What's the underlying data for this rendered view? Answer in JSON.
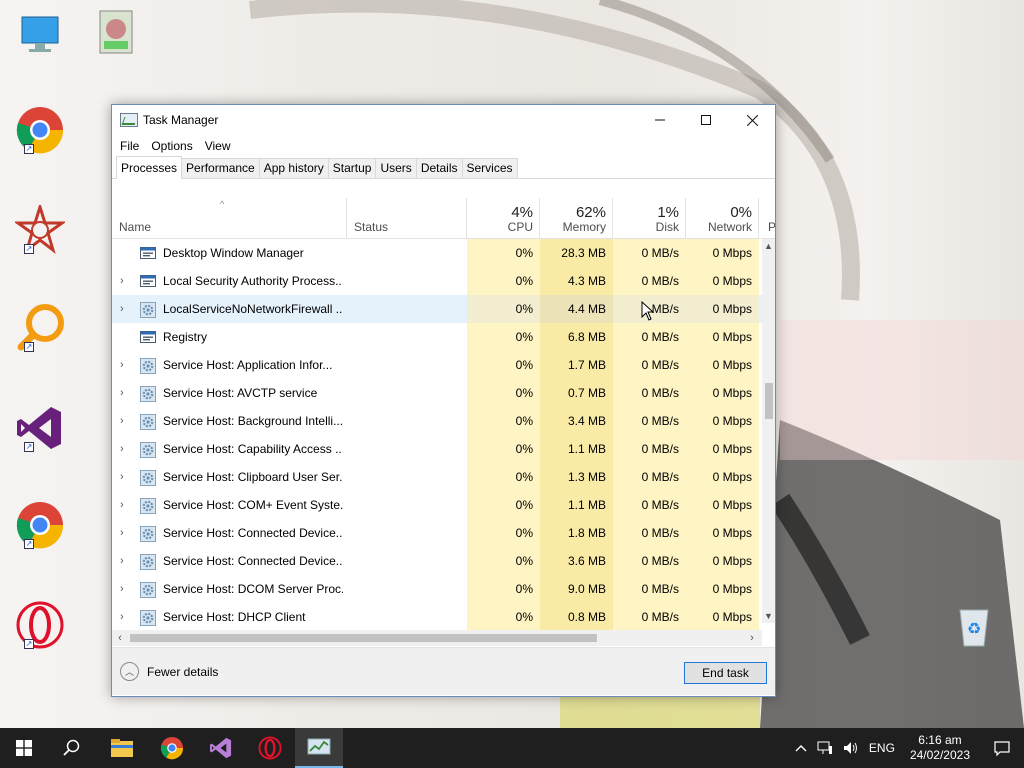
{
  "window": {
    "title": "Task Manager",
    "controls": {
      "minimize": "—",
      "maximize": "☐",
      "close": "✕"
    }
  },
  "menu": [
    "File",
    "Options",
    "View"
  ],
  "tabs": [
    "Processes",
    "Performance",
    "App history",
    "Startup",
    "Users",
    "Details",
    "Services"
  ],
  "columns": {
    "name": "Name",
    "status": "Status",
    "cpu": {
      "pct": "4%",
      "label": "CPU"
    },
    "memory": {
      "pct": "62%",
      "label": "Memory"
    },
    "disk": {
      "pct": "1%",
      "label": "Disk"
    },
    "network": {
      "pct": "0%",
      "label": "Network"
    },
    "power": "P"
  },
  "processes": [
    {
      "name": "Desktop Window Manager",
      "expandable": false,
      "icon": "app-window-icon",
      "cpu": "0%",
      "memory": "28.3 MB",
      "disk": "0 MB/s",
      "network": "0 Mbps"
    },
    {
      "name": "Local Security Authority Process...",
      "expandable": true,
      "icon": "app-window-icon",
      "cpu": "0%",
      "memory": "4.3 MB",
      "disk": "0 MB/s",
      "network": "0 Mbps"
    },
    {
      "name": "LocalServiceNoNetworkFirewall ...",
      "expandable": true,
      "icon": "gear-icon",
      "cpu": "0%",
      "memory": "4.4 MB",
      "disk": "MB/s",
      "network": "0 Mbps",
      "hover": true
    },
    {
      "name": "Registry",
      "expandable": false,
      "icon": "app-window-icon",
      "cpu": "0%",
      "memory": "6.8 MB",
      "disk": "0 MB/s",
      "network": "0 Mbps"
    },
    {
      "name": "Service Host: Application Infor...",
      "expandable": true,
      "icon": "gear-icon",
      "cpu": "0%",
      "memory": "1.7 MB",
      "disk": "0 MB/s",
      "network": "0 Mbps"
    },
    {
      "name": "Service Host: AVCTP service",
      "expandable": true,
      "icon": "gear-icon",
      "cpu": "0%",
      "memory": "0.7 MB",
      "disk": "0 MB/s",
      "network": "0 Mbps"
    },
    {
      "name": "Service Host: Background Intelli...",
      "expandable": true,
      "icon": "gear-icon",
      "cpu": "0%",
      "memory": "3.4 MB",
      "disk": "0 MB/s",
      "network": "0 Mbps"
    },
    {
      "name": "Service Host: Capability Access ...",
      "expandable": true,
      "icon": "gear-icon",
      "cpu": "0%",
      "memory": "1.1 MB",
      "disk": "0 MB/s",
      "network": "0 Mbps"
    },
    {
      "name": "Service Host: Clipboard User Ser...",
      "expandable": true,
      "icon": "gear-icon",
      "cpu": "0%",
      "memory": "1.3 MB",
      "disk": "0 MB/s",
      "network": "0 Mbps"
    },
    {
      "name": "Service Host: COM+ Event Syste...",
      "expandable": true,
      "icon": "gear-icon",
      "cpu": "0%",
      "memory": "1.1 MB",
      "disk": "0 MB/s",
      "network": "0 Mbps"
    },
    {
      "name": "Service Host: Connected Device...",
      "expandable": true,
      "icon": "gear-icon",
      "cpu": "0%",
      "memory": "1.8 MB",
      "disk": "0 MB/s",
      "network": "0 Mbps"
    },
    {
      "name": "Service Host: Connected Device...",
      "expandable": true,
      "icon": "gear-icon",
      "cpu": "0%",
      "memory": "3.6 MB",
      "disk": "0 MB/s",
      "network": "0 Mbps"
    },
    {
      "name": "Service Host: DCOM Server Proc...",
      "expandable": true,
      "icon": "gear-icon",
      "cpu": "0%",
      "memory": "9.0 MB",
      "disk": "0 MB/s",
      "network": "0 Mbps"
    },
    {
      "name": "Service Host: DHCP Client",
      "expandable": true,
      "icon": "gear-icon",
      "cpu": "0%",
      "memory": "0.8 MB",
      "disk": "0 MB/s",
      "network": "0 Mbps"
    }
  ],
  "footer": {
    "fewer_details": "Fewer details",
    "end_task": "End task"
  },
  "taskbar": {
    "items": [
      "start-icon",
      "search-icon",
      "file-explorer-icon",
      "chrome-icon",
      "visual-studio-icon",
      "opera-icon",
      "task-manager-icon"
    ],
    "language": "ENG",
    "time": "6:16 am",
    "date": "24/02/2023"
  },
  "desktop_icons": [
    "this-pc-icon",
    "user-file-icon",
    "chrome-icon",
    "app-star-icon",
    "search-app-icon",
    "visual-studio-icon",
    "chrome-icon",
    "opera-icon",
    "recycle-bin-icon"
  ],
  "colors": {
    "heat_light": "#fff4c4",
    "heat_mid": "#f9eba6",
    "hover_row": "#e5f1fb",
    "accent": "#1e78d7",
    "taskbar": "#1f1f1f"
  }
}
